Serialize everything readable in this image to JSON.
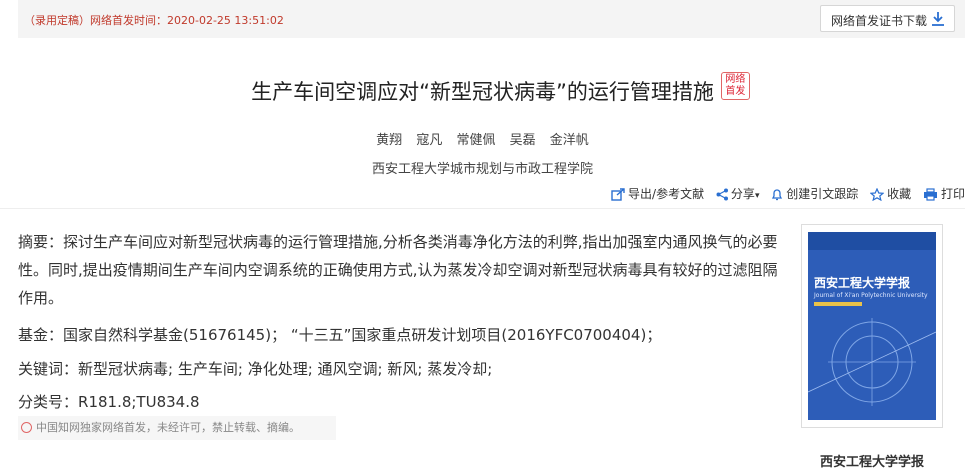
{
  "header": {
    "status_text": "（录用定稿）网络首发时间：2020-02-25 13:51:02",
    "cert_download_label": "网络首发证书下载",
    "cert_icon": "download-icon"
  },
  "article": {
    "title": "生产车间空调应对“新型冠状病毒”的运行管理措施",
    "badge_line1": "网络",
    "badge_line2": "首发",
    "authors": [
      "黄翔",
      "寇凡",
      "常健佩",
      "吴磊",
      "金洋帆"
    ],
    "organization": "西安工程大学城市规划与市政工程学院"
  },
  "toolbar": {
    "export": "导出/参考文献",
    "share": "分享",
    "alert": "创建引文跟踪",
    "favorite": "收藏",
    "print": "打印"
  },
  "abstract": {
    "label": "摘要：",
    "text": "探讨生产车间应对新型冠状病毒的运行管理措施,分析各类消毒净化方法的利弊,指出加强室内通风换气的必要性。同时,提出疫情期间生产车间内空调系统的正确使用方式,认为蒸发冷却空调对新型冠状病毒具有较好的过滤阻隔作用。"
  },
  "fund": {
    "label": "基金：",
    "value": "国家自然科学基金(51676145)；  “十三五”国家重点研发计划项目(2016YFC0700404)；"
  },
  "keywords": {
    "label": "关键词：",
    "items": [
      "新型冠状病毒;",
      "生产车间;",
      "净化处理;",
      "通风空调;",
      "新风;",
      "蒸发冷却;"
    ]
  },
  "classification": {
    "label": "分类号：",
    "value": "R181.8;TU834.8"
  },
  "notice": "中国知网独家网络首发，未经许可，禁止转载、摘编。",
  "journal": {
    "cover_name": "西安工程大学学报",
    "cover_english": "Journal of Xi'an Polytechnic University",
    "name": "西安工程大学学报"
  },
  "colors": {
    "status_red": "#c0392b",
    "cover_blue": "#2d5db8",
    "icon_blue": "#2a6fd1"
  }
}
